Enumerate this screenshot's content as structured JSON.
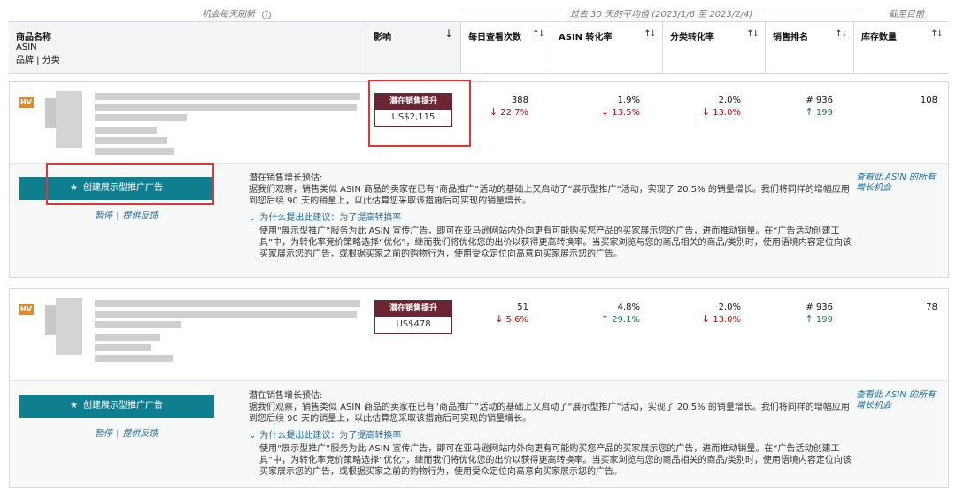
{
  "top": {
    "refresh_note": "机会每天刷新",
    "avg_label": "过去 30 天的平均值 (2023/1/6 至 2023/2/4)",
    "as_of": "截至目前"
  },
  "header": {
    "product_name": "商品名称",
    "asin": "ASIN",
    "brand_category": "品牌 | 分类",
    "impact": "影响",
    "daily_views": "每日查看次数",
    "asin_conversion": "ASIN 转化率",
    "category_conversion": "分类转化率",
    "sales_rank": "销售排名",
    "inventory": "库存数量"
  },
  "rows": [
    {
      "badge": "HV",
      "impact_label": "潜在销售提升",
      "impact_value": "US$2,115",
      "views": "388",
      "views_delta": "22.7%",
      "asin_conv": "1.9%",
      "asin_conv_delta": "13.5%",
      "cat_conv": "2.0%",
      "cat_conv_delta": "13.0%",
      "rank": "# 936",
      "rank_delta": "199",
      "inventory": "108",
      "cta": "创建展示型推广广告",
      "pause": "暂停",
      "feedback": "提供反馈",
      "est_title": "潜在销售增长预估:",
      "est_body": "据我们观察，销售类似 ASIN 商品的卖家在已有“商品推广”活动的基础上又启动了“展示型推广”活动，实现了 20.5% 的销量增长。我们将同样的增幅应用到您后续 90 天的销量上，以此估算您采取该措施后可实现的销量增长。",
      "why": "为什么提出此建议：为了提高转换率",
      "reason": "使用“展示型推广”服务为此 ASIN 宣传广告，即可在亚马逊网站内外向更有可能购买您产品的买家展示您的广告，进而推动销量。在“广告活动创建工具”中，为转化率竞价策略选择“优化”，继而我们将优化您的出价以获得更高转换率。当买家浏览与您的商品相关的商品/类别时，使用语境内容定位向该买家展示您的广告，或根据买家之前的购物行为，使用受众定位向高意向买家展示您的广告。",
      "see_all": "查看此 ASIN 的所有增长机会"
    },
    {
      "badge": "HV",
      "impact_label": "潜在销售提升",
      "impact_value": "US$478",
      "views": "51",
      "views_delta": "5.6%",
      "asin_conv": "4.8%",
      "asin_conv_delta": "29.1%",
      "cat_conv": "2.0%",
      "cat_conv_delta": "13.0%",
      "rank": "# 936",
      "rank_delta": "199",
      "inventory": "78",
      "cta": "创建展示型推广广告",
      "pause": "暂停",
      "feedback": "提供反馈",
      "est_title": "潜在销售增长预估:",
      "est_body": "据我们观察，销售类似 ASIN 商品的卖家在已有“商品推广”活动的基础上又启动了“展示型推广”活动，实现了 20.5% 的销量增长。我们将同样的增幅应用到您后续 90 天的销量上，以此估算您采取该措施后可实现的销量增长。",
      "why": "为什么提出此建议：为了提高转换率",
      "reason": "使用“展示型推广”服务为此 ASIN 宣传广告，即可在亚马逊网站内外向更有可能购买您产品的买家展示您的广告，进而推动销量。在“广告活动创建工具”中，为转化率竞价策略选择“优化”，继而我们将优化您的出价以获得更高转换率。当买家浏览与您的商品相关的商品/类别时，使用语境内容定位向该买家展示您的广告，或根据买家之前的购物行为，使用受众定位向高意向买家展示您的广告。",
      "see_all": "查看此 ASIN 的所有增长机会"
    }
  ],
  "colors": {
    "accent": "#0f7f8f",
    "impact": "#6b2533",
    "down": "#c40000",
    "up": "#067d62",
    "link": "#1a6fa8",
    "highlight": "#e0353a"
  }
}
